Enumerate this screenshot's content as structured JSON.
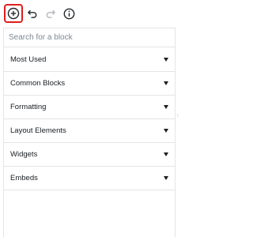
{
  "toolbar": {
    "add_icon": "plus-circle-icon",
    "undo_icon": "undo-icon",
    "redo_icon": "redo-icon",
    "info_icon": "info-icon",
    "highlight_color": "#e01e1e"
  },
  "search": {
    "placeholder": "Search for a block",
    "value": ""
  },
  "sections": [
    {
      "label": "Most Used"
    },
    {
      "label": "Common Blocks"
    },
    {
      "label": "Formatting"
    },
    {
      "label": "Layout Elements"
    },
    {
      "label": "Widgets"
    },
    {
      "label": "Embeds"
    }
  ]
}
